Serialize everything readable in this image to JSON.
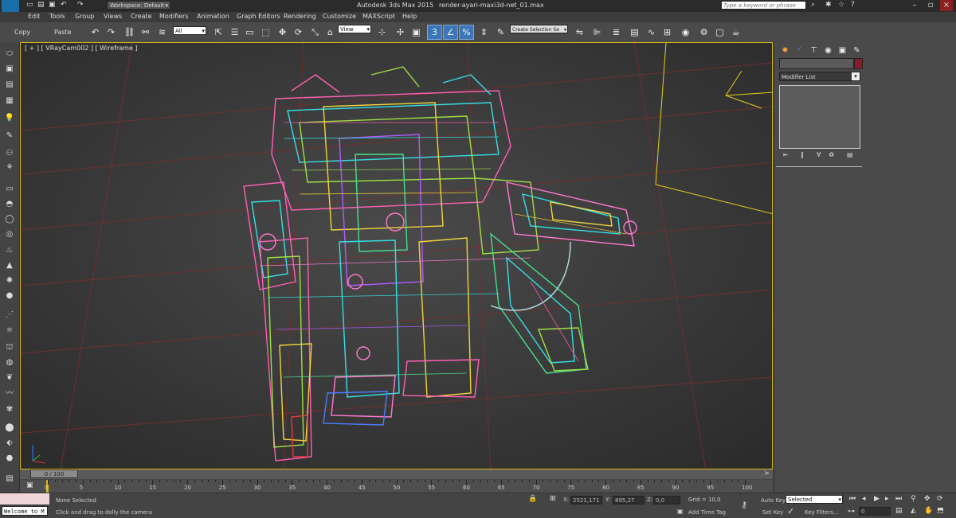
{
  "title_bar": {
    "app_name": "Autodesk 3ds Max  2015",
    "file_name": "render-ayari-maxi3d-net_01.max",
    "workspace": "Workspace: Default",
    "search_placeholder": "Type a keyword or phrase",
    "max_logo": "MAX"
  },
  "menu": {
    "items": [
      "Edit",
      "Tools",
      "Group",
      "Views",
      "Create",
      "Modifiers",
      "Animation",
      "Graph Editors",
      "Rendering",
      "Customize",
      "MAXScript",
      "Help"
    ]
  },
  "toolbar": {
    "copy_label": "Copy",
    "paste_label": "Paste",
    "filter_value": "All",
    "ref_coord_value": "View",
    "selection_set_value": "Create Selection Se"
  },
  "viewport": {
    "label": "[ + ] [ VRayCam002 ] [ Wireframe ]"
  },
  "command_panel": {
    "modifier_list_label": "Modifier List",
    "object_color": "#8b1a2b"
  },
  "timeline": {
    "frame_display": "0 / 100",
    "ticks": [
      "0",
      "5",
      "10",
      "15",
      "20",
      "25",
      "30",
      "35",
      "40",
      "45",
      "50",
      "55",
      "60",
      "65",
      "70",
      "75",
      "80",
      "85",
      "90",
      "95",
      "100"
    ]
  },
  "status": {
    "welcome_text": "Welcome to M",
    "selection_text": "None Selected",
    "prompt_text": "Click and drag to dolly the camera",
    "x_label": "X:",
    "x_value": "2521,171",
    "y_label": "Y:",
    "y_value": "895,27",
    "z_label": "Z:",
    "z_value": "0,0",
    "grid_text": "Grid = 10,0",
    "add_time_tag": "Add Time Tag",
    "auto_key": "Auto Key",
    "set_key": "Set Key",
    "auto_key_value": "Selected",
    "key_filters": "Key Filters...",
    "frame_value": "0"
  },
  "colors": {
    "viewport_border": "#d9b81a",
    "camera_color": "#e5d01a",
    "active_tool": "#3c76b8"
  }
}
